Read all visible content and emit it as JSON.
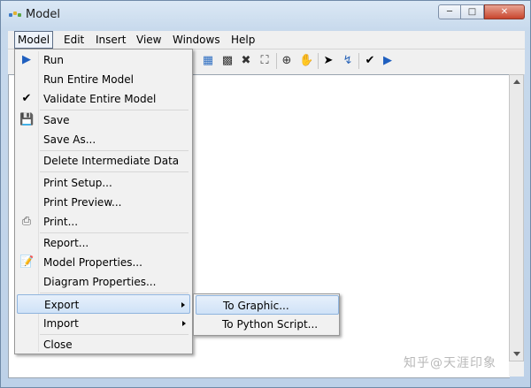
{
  "window": {
    "title": "Model",
    "minimize_icon": "minimize-icon",
    "maximize_icon": "maximize-icon",
    "close_icon": "close-icon"
  },
  "menubar": {
    "items": [
      "Model",
      "Edit",
      "Insert",
      "View",
      "Windows",
      "Help"
    ],
    "active": "Model"
  },
  "toolbar": {
    "icons": [
      "select-all-icon",
      "fit-to-window-icon",
      "full-extent-icon",
      "zoom-to-layer-icon",
      "zoom-in-icon",
      "pan-icon",
      "select-pointer-icon",
      "connect-icon",
      "validate-icon",
      "run-icon"
    ]
  },
  "model_menu": {
    "items": [
      {
        "label": "Run",
        "icon": "run-arrow-icon"
      },
      {
        "label": "Run Entire Model",
        "icon": ""
      },
      {
        "label": "Validate Entire Model",
        "icon": "checkmark-icon"
      },
      {
        "label": "Save",
        "icon": "floppy-disk-icon"
      },
      {
        "label": "Save As...",
        "icon": ""
      },
      {
        "label": "Delete Intermediate Data",
        "icon": ""
      },
      {
        "label": "Print Setup...",
        "icon": ""
      },
      {
        "label": "Print Preview...",
        "icon": ""
      },
      {
        "label": "Print...",
        "icon": "printer-icon"
      },
      {
        "label": "Report...",
        "icon": ""
      },
      {
        "label": "Model Properties...",
        "icon": "properties-icon"
      },
      {
        "label": "Diagram Properties...",
        "icon": ""
      },
      {
        "label": "Export",
        "icon": "",
        "submenu": true
      },
      {
        "label": "Import",
        "icon": "",
        "submenu": true
      },
      {
        "label": "Close",
        "icon": ""
      }
    ],
    "highlighted": "Export"
  },
  "export_submenu": {
    "items": [
      "To Graphic...",
      "To Python Script..."
    ],
    "highlighted": "To Graphic..."
  },
  "watermark": "知乎@天涯印象",
  "colors": {
    "highlight_bg": "#cfe2f7",
    "highlight_border": "#8fb4de",
    "title_bar": "#c7d9ec"
  }
}
